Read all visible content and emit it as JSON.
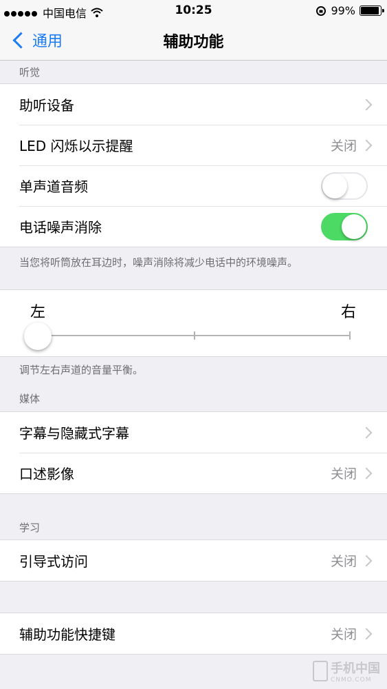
{
  "status_bar": {
    "carrier": "中国电信",
    "time": "10:25",
    "battery": "99%",
    "icons": [
      "signal-dots-icon",
      "wifi-icon",
      "rotation-lock-icon",
      "battery-icon"
    ]
  },
  "nav": {
    "back_label": "通用",
    "title": "辅助功能"
  },
  "hearing": {
    "header": "听觉",
    "items": [
      {
        "label": "助听设备",
        "value": ""
      },
      {
        "label": "LED 闪烁以示提醒",
        "value": "关闭"
      },
      {
        "label": "单声道音频",
        "toggle": "off"
      },
      {
        "label": "电话噪声消除",
        "toggle": "on"
      }
    ],
    "footer": "当您将听筒放在耳边时，噪声消除将减少电话中的环境噪声。"
  },
  "balance": {
    "left_label": "左",
    "right_label": "右",
    "value": 0,
    "footer": "调节左右声道的音量平衡。"
  },
  "media": {
    "header": "媒体",
    "items": [
      {
        "label": "字幕与隐藏式字幕",
        "value": ""
      },
      {
        "label": "口述影像",
        "value": "关闭"
      }
    ]
  },
  "learning": {
    "header": "学习",
    "items": [
      {
        "label": "引导式访问",
        "value": "关闭"
      }
    ]
  },
  "shortcut": {
    "items": [
      {
        "label": "辅助功能快捷键",
        "value": "关闭"
      }
    ]
  },
  "watermark": {
    "text": "手机中国",
    "sub": "CNMO.COM"
  },
  "colors": {
    "accent": "#1b7cf4",
    "toggle_on": "#4cd964",
    "background": "#efeff4"
  }
}
